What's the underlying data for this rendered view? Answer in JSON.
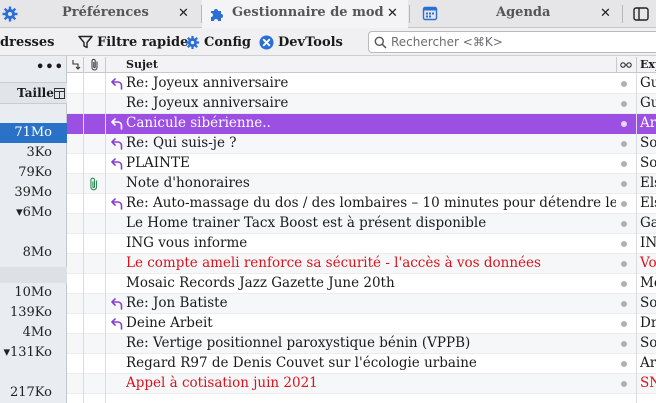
{
  "tabs": [
    {
      "label": "Préférences",
      "icon": "gear-icon"
    },
    {
      "label": "Gestionnaire de modules",
      "icon": "puzzle-icon"
    },
    {
      "label": "Agenda",
      "icon": "calendar-icon"
    }
  ],
  "toolbar": {
    "addresses_label": "dresses",
    "filter_label": "Filtre rapide",
    "config_label": "Config",
    "devtools_label": "DevTools",
    "search_placeholder": "Rechercher <⌘K>"
  },
  "left_pane": {
    "more_label": "•••",
    "size_header": "Taille",
    "sizes": [
      {
        "text": "71Mo",
        "selected": true
      },
      {
        "text": "3Ko"
      },
      {
        "text": "79Ko"
      },
      {
        "text": "39Mo"
      },
      {
        "text": "▾6Mo"
      },
      {
        "text": "8Mo"
      },
      {
        "text": "10Mo"
      },
      {
        "text": "139Ko"
      },
      {
        "text": "4Mo"
      },
      {
        "text": "▾131Ko"
      },
      {
        "text": "217Ko"
      }
    ]
  },
  "columns": {
    "subject": "Sujet",
    "sender": "Exp"
  },
  "messages": [
    {
      "subject": "Re: Joyeux anniversaire",
      "sender": "Gu",
      "reply": true
    },
    {
      "subject": "Re: Joyeux anniversaire",
      "sender": "Gu",
      "reply": false
    },
    {
      "subject": "Canicule sibérienne..",
      "sender": "Ar",
      "reply": true,
      "selected": true
    },
    {
      "subject": "Re: Qui suis-je ?",
      "sender": "Sol",
      "reply": true
    },
    {
      "subject": "PLAINTE",
      "sender": "Sol",
      "reply": true
    },
    {
      "subject": "Note d'honoraires",
      "sender": "Els",
      "attach": true
    },
    {
      "subject": "Re: Auto-massage du dos / des lombaires – 10 minutes pour détendre le dos",
      "sender": "Els",
      "reply": true
    },
    {
      "subject": "Le Home trainer Tacx Boost est à présent disponible",
      "sender": "Ga"
    },
    {
      "subject": "ING vous informe",
      "sender": "IN"
    },
    {
      "subject": "Le compte ameli renforce sa sécurité - l'accès à vos données",
      "sender": "Vo",
      "red": true
    },
    {
      "subject": "Mosaic Records Jazz Gazette June 20th",
      "sender": "Mo"
    },
    {
      "subject": "Re: Jon Batiste",
      "sender": "Sol",
      "reply": true
    },
    {
      "subject": "Deine Arbeit",
      "sender": "Dr",
      "reply": true
    },
    {
      "subject": "Re: Vertige positionnel paroxystique bénin (VPPB)",
      "sender": "Sol"
    },
    {
      "subject": "Regard R97 de Denis Couvet sur l'écologie urbaine",
      "sender": "Ar"
    },
    {
      "subject": "Appel à cotisation juin 2021",
      "sender": "SN",
      "red": true
    }
  ],
  "colors": {
    "selected_row": "#9b4fe3",
    "left_selected": "#2a72c8",
    "reply_arrow": "#8a3fd1",
    "warning_text": "#d9131b",
    "accent_icon": "#2a6fd6"
  }
}
